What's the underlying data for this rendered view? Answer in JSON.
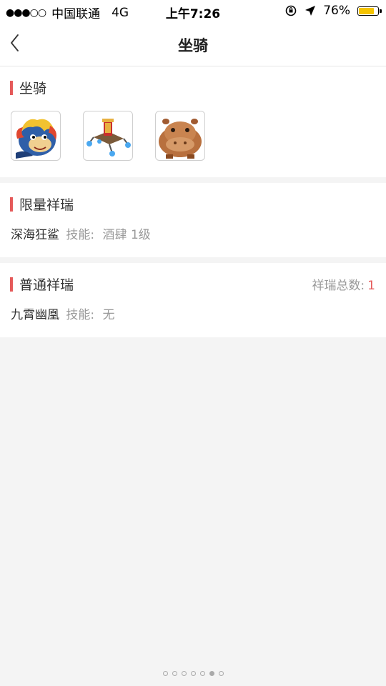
{
  "status": {
    "signal": "●●●○○",
    "carrier": "中国联通",
    "network": "4G",
    "time": "上午7:26",
    "battery": "76%",
    "battery_level": 0.76,
    "battery_color": "#f5c400"
  },
  "nav": {
    "title": "坐骑"
  },
  "mounts": {
    "title": "坐骑",
    "items": [
      "blue-dragon-mount-icon",
      "flying-cart-mount-icon",
      "hippo-mount-icon"
    ]
  },
  "limited": {
    "title": "限量祥瑞",
    "entry": {
      "name": "深海狂鲨",
      "skill_label": "技能:",
      "skill_value": "酒肆 1级"
    }
  },
  "normal": {
    "title": "普通祥瑞",
    "total_label": "祥瑞总数:",
    "total_count": "1",
    "entry": {
      "name": "九霄幽凰",
      "skill_label": "技能:",
      "skill_value": "无"
    }
  },
  "pager": {
    "count": 7,
    "active_index": 5
  },
  "colors": {
    "accent": "#e55a5a",
    "background": "#f4f4f4"
  }
}
